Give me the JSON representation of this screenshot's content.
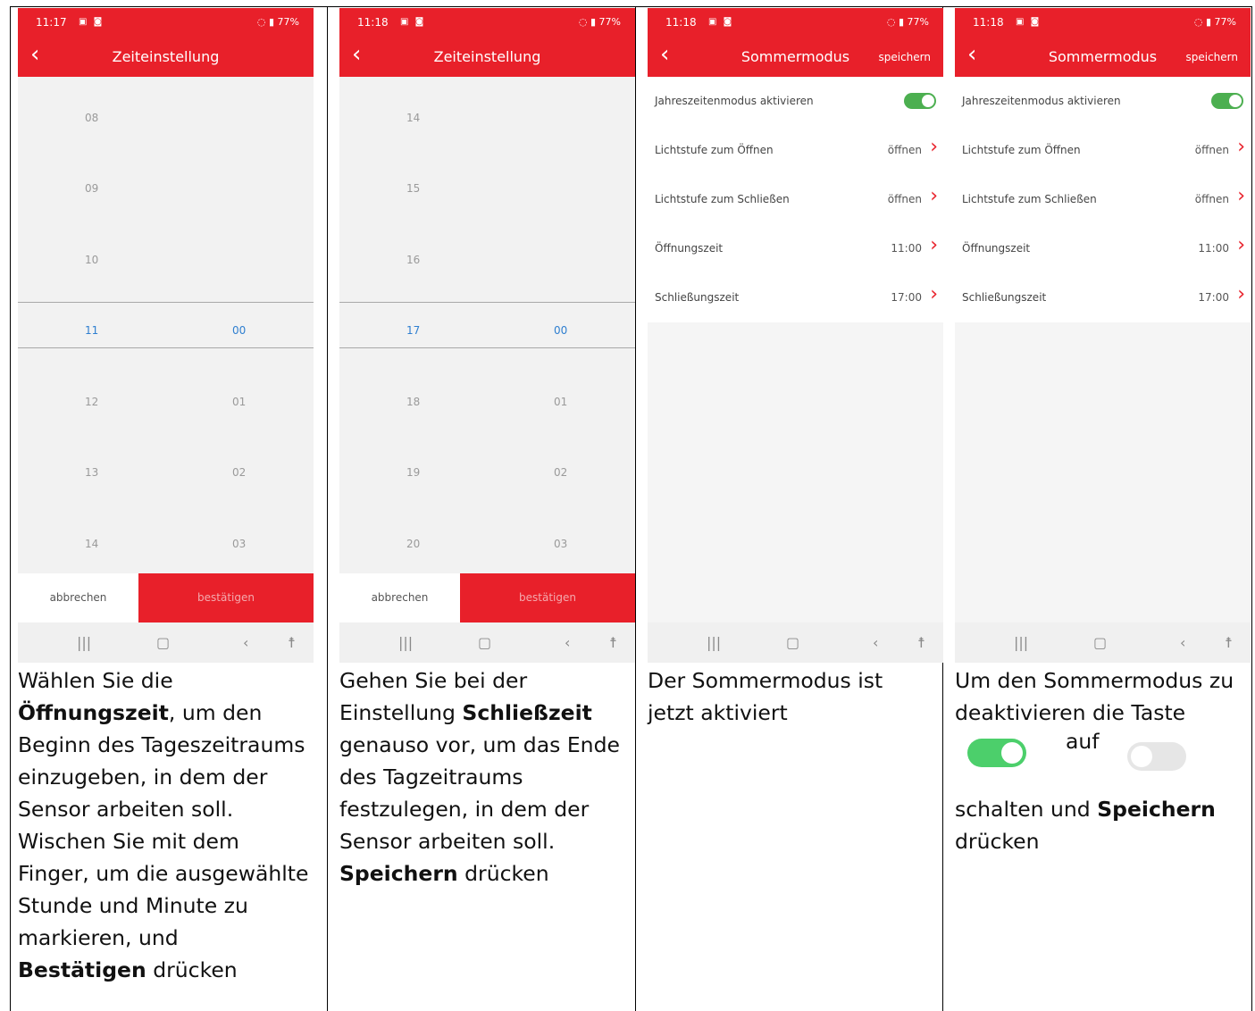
{
  "panel1": {
    "status_time": "11:17",
    "status_right": "77%",
    "title": "Zeiteinstellung",
    "hours": [
      "08",
      "09",
      "10",
      "11",
      "12",
      "13",
      "14"
    ],
    "minutes": [
      "00",
      "01",
      "02",
      "03"
    ],
    "cancel": "abbrechen",
    "confirm": "bestätigen",
    "caption": {
      "t1": "Wählen Sie die ",
      "b1": "Öffnungszeit",
      "t2": ", um den Beginn des Tageszeitraums einzugeben, in dem der Sensor arbeiten soll. Wischen Sie mit dem Finger, um die ausgewählte Stunde und Minute zu markieren, und ",
      "b2": "Bestätigen",
      "t3": " drücken"
    }
  },
  "panel2": {
    "status_time": "11:18",
    "status_right": "77%",
    "title": "Zeiteinstellung",
    "hours": [
      "14",
      "15",
      "16",
      "17",
      "18",
      "19",
      "20"
    ],
    "minutes": [
      "00",
      "01",
      "02",
      "03"
    ],
    "cancel": "abbrechen",
    "confirm": "bestätigen",
    "caption": {
      "t1": "Gehen Sie bei der Einstellung ",
      "b1": "Schließzeit",
      "t2": " genauso vor, um das Ende des Tagzeitraums festzulegen, in dem der Sensor arbeiten soll. ",
      "b2": "Speichern",
      "t3": " drücken"
    }
  },
  "panel3": {
    "status_time": "11:18",
    "status_right": "77%",
    "title": "Sommermodus",
    "save": "speichern",
    "rows": [
      {
        "label": "Jahreszeitenmodus aktivieren",
        "value": ""
      },
      {
        "label": "Lichtstufe zum Öffnen",
        "value": "öffnen"
      },
      {
        "label": "Lichtstufe zum Schließen",
        "value": "öffnen"
      },
      {
        "label": "Öffnungszeit",
        "value": "11:00"
      },
      {
        "label": "Schließungszeit",
        "value": "17:00"
      }
    ],
    "caption": "Der Sommermodus ist jetzt aktiviert"
  },
  "panel4": {
    "status_time": "11:18",
    "status_right": "77%",
    "title": "Sommermodus",
    "save": "speichern",
    "rows": [
      {
        "label": "Jahreszeitenmodus aktivieren",
        "value": ""
      },
      {
        "label": "Lichtstufe zum Öffnen",
        "value": "öffnen"
      },
      {
        "label": "Lichtstufe zum Schließen",
        "value": "öffnen"
      },
      {
        "label": "Öffnungszeit",
        "value": "11:00"
      },
      {
        "label": "Schließungszeit",
        "value": "17:00"
      }
    ],
    "caption": {
      "t1": "Um den Sommermodus zu deaktivieren die Taste",
      "auf": "auf",
      "t2": "schalten und ",
      "b1": "Speichern",
      "t3": " drücken"
    }
  },
  "nav_icons": [
    "recent-apps-icon",
    "home-icon",
    "back-icon",
    "accessibility-icon"
  ],
  "colors": {
    "brand_red": "#e8202a",
    "selected_blue": "#2f7fd0",
    "toggle_green": "#4caf50"
  }
}
